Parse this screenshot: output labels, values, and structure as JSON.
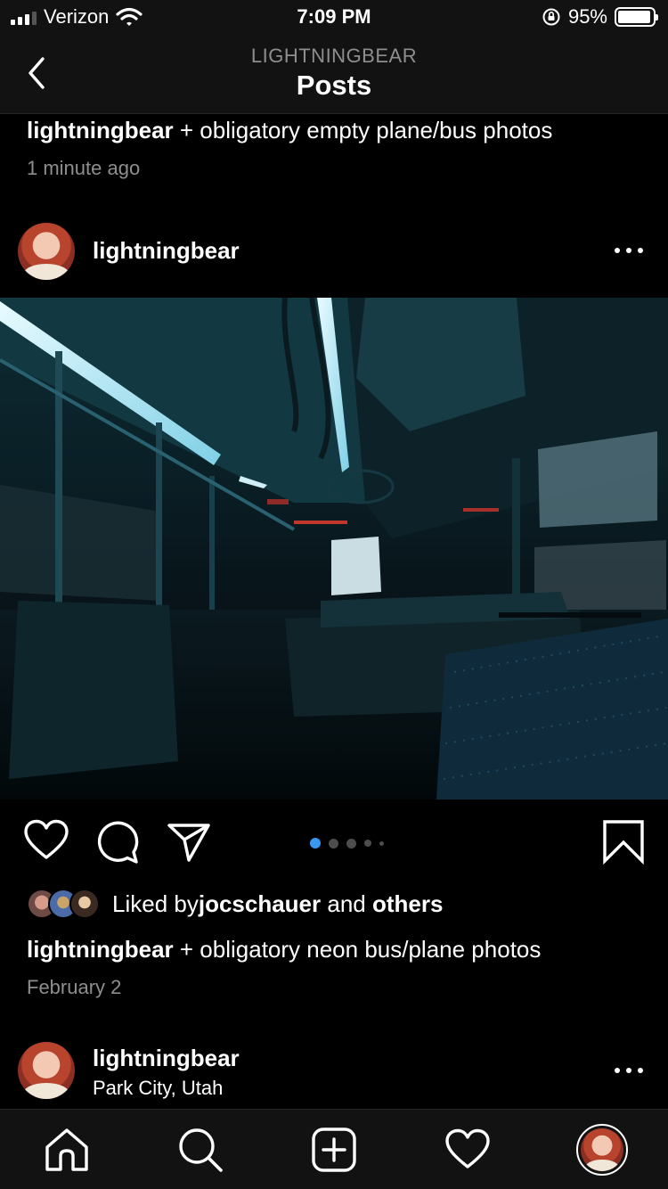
{
  "status_bar": {
    "carrier": "Verizon",
    "time": "7:09 PM",
    "battery_percent": "95%",
    "battery_level": 0.95,
    "signal_bars": 3
  },
  "header": {
    "subtitle": "LIGHTNINGBEAR",
    "title": "Posts",
    "back_icon": "chevron-left-icon"
  },
  "previous_post": {
    "username": "lightningbear",
    "caption": " + obligatory empty plane/bus photos",
    "timestamp": "1 minute ago"
  },
  "post": {
    "username": "lightningbear",
    "image_description_icon": "bus-interior-photo",
    "carousel": {
      "count": 5,
      "active_index": 0
    },
    "liked_by_prefix": "Liked by ",
    "liked_by_user": "jocschauer",
    "liked_by_and": " and ",
    "liked_by_others": "others",
    "caption_username": "lightningbear",
    "caption": " + obligatory neon bus/plane photos",
    "timestamp": "February 2"
  },
  "next_post": {
    "username": "lightningbear",
    "location": "Park City, Utah"
  },
  "tab_bar": {
    "items": [
      "home-icon",
      "search-icon",
      "new-post-icon",
      "activity-heart-icon",
      "profile-avatar"
    ]
  },
  "colors": {
    "background": "#000000",
    "bar_background": "#121212",
    "muted_text": "#8e8e8e",
    "carousel_active": "#3897f0"
  }
}
